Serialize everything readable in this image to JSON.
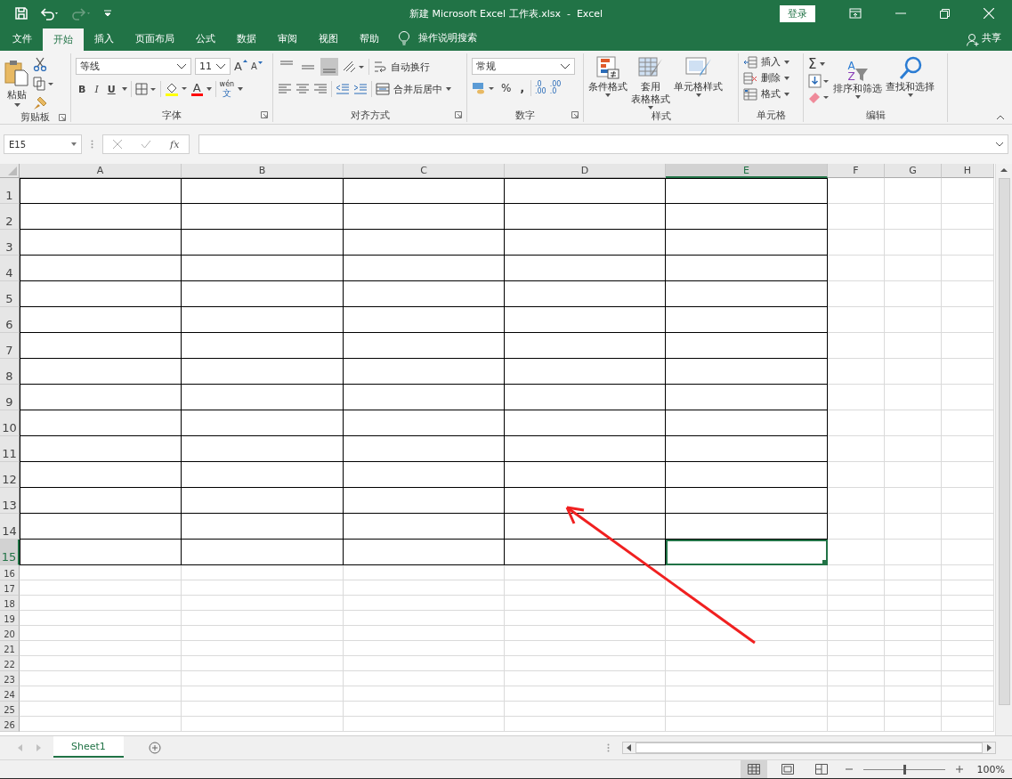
{
  "window": {
    "title": "新建 Microsoft Excel 工作表.xlsx  -  Excel",
    "login": "登录"
  },
  "tabs": [
    {
      "label": "文件",
      "selected": false
    },
    {
      "label": "开始",
      "selected": true
    },
    {
      "label": "插入",
      "selected": false
    },
    {
      "label": "页面布局",
      "selected": false
    },
    {
      "label": "公式",
      "selected": false
    },
    {
      "label": "数据",
      "selected": false
    },
    {
      "label": "审阅",
      "selected": false
    },
    {
      "label": "视图",
      "selected": false
    },
    {
      "label": "帮助",
      "selected": false
    }
  ],
  "tell_me": "操作说明搜索",
  "share": "共享",
  "ribbon": {
    "clipboard": {
      "label": "剪贴板",
      "paste": "粘贴"
    },
    "font": {
      "label": "字体",
      "font_name": "等线",
      "font_size": "11",
      "grow": "A",
      "shrink": "A",
      "bold": "B",
      "italic": "I",
      "underline": "U",
      "font_color": "A",
      "phonetic": "wén",
      "phonetic_char": "文"
    },
    "alignment": {
      "label": "对齐方式",
      "vertical": [
        {
          "selected": false
        },
        {
          "selected": false
        },
        {
          "selected": true
        }
      ],
      "wrap_text": "自动换行",
      "merge_center": "合并后居中"
    },
    "number": {
      "label": "数字",
      "format": "常规",
      "percent": "%",
      "comma": ",",
      "increase_decimal": [
        ".0",
        ".00"
      ],
      "decrease_decimal": [
        ".00",
        ".0"
      ]
    },
    "styles": {
      "label": "样式",
      "buttons": [
        {
          "kind": "conditional",
          "lines": [
            "条件格式"
          ]
        },
        {
          "kind": "table",
          "lines": [
            "套用",
            "表格格式"
          ]
        },
        {
          "kind": "cell",
          "lines": [
            "单元格样式"
          ]
        }
      ]
    },
    "cells": {
      "label": "单元格",
      "buttons": [
        {
          "kind": "insert",
          "label": "插入"
        },
        {
          "kind": "delete",
          "label": "删除"
        },
        {
          "kind": "format",
          "label": "格式"
        }
      ]
    },
    "editing": {
      "label": "编辑",
      "sum": "Σ",
      "sort_letters": [
        "A",
        "Z"
      ],
      "sort_filter": "排序和筛选",
      "find_select": "查找和选择"
    }
  },
  "formula_bar": {
    "name_box": "E15",
    "fx": "fx"
  },
  "sheet": {
    "columns": [
      {
        "label": "A",
        "in_table": true,
        "selected": false
      },
      {
        "label": "B",
        "in_table": true,
        "selected": false
      },
      {
        "label": "C",
        "in_table": true,
        "selected": false
      },
      {
        "label": "D",
        "in_table": true,
        "selected": false
      },
      {
        "label": "E",
        "in_table": true,
        "selected": true
      },
      {
        "label": "F",
        "in_table": false,
        "selected": false
      },
      {
        "label": "G",
        "in_table": false,
        "selected": false
      },
      {
        "label": "H",
        "in_table": false,
        "selected": false
      }
    ],
    "rows": [
      {
        "label": "1",
        "kind": "table",
        "selected": false
      },
      {
        "label": "2",
        "kind": "table",
        "selected": false
      },
      {
        "label": "3",
        "kind": "table",
        "selected": false
      },
      {
        "label": "4",
        "kind": "table",
        "selected": false
      },
      {
        "label": "5",
        "kind": "table",
        "selected": false
      },
      {
        "label": "6",
        "kind": "table",
        "selected": false
      },
      {
        "label": "7",
        "kind": "table",
        "selected": false
      },
      {
        "label": "8",
        "kind": "table",
        "selected": false
      },
      {
        "label": "9",
        "kind": "table",
        "selected": false
      },
      {
        "label": "10",
        "kind": "table",
        "selected": false
      },
      {
        "label": "11",
        "kind": "table",
        "selected": false
      },
      {
        "label": "12",
        "kind": "table",
        "selected": false
      },
      {
        "label": "13",
        "kind": "table",
        "selected": false
      },
      {
        "label": "14",
        "kind": "table",
        "selected": false
      },
      {
        "label": "15",
        "kind": "table",
        "selected": true
      },
      {
        "label": "16",
        "kind": "plain",
        "selected": false
      },
      {
        "label": "17",
        "kind": "plain",
        "selected": false
      },
      {
        "label": "18",
        "kind": "plain",
        "selected": false
      },
      {
        "label": "19",
        "kind": "plain",
        "selected": false
      },
      {
        "label": "20",
        "kind": "plain",
        "selected": false
      },
      {
        "label": "21",
        "kind": "plain",
        "selected": false
      },
      {
        "label": "22",
        "kind": "plain",
        "selected": false
      },
      {
        "label": "23",
        "kind": "plain",
        "selected": false
      },
      {
        "label": "24",
        "kind": "plain",
        "selected": false
      },
      {
        "label": "25",
        "kind": "plain",
        "selected": false
      },
      {
        "label": "26",
        "kind": "plain",
        "selected": false
      }
    ]
  },
  "annotation": {
    "kind": "arrow"
  },
  "sheet_tabs": [
    {
      "label": "Sheet1",
      "selected": true
    }
  ],
  "status_bar": {
    "views": [
      {
        "kind": "normal",
        "selected": true
      },
      {
        "kind": "page_layout",
        "selected": false
      },
      {
        "kind": "page_break",
        "selected": false
      }
    ],
    "zoom": {
      "level": 0.5,
      "reading": "100%"
    }
  }
}
